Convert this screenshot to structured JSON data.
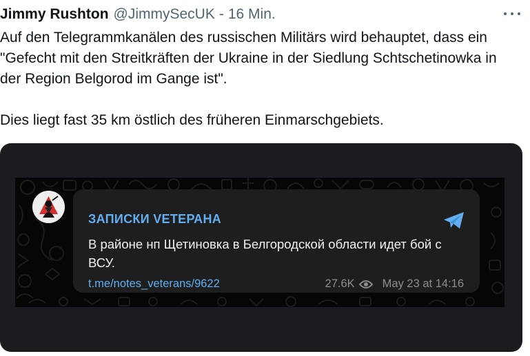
{
  "tweet": {
    "author_name": "Jimmy Rushton",
    "author_handle": "@JimmySecUK",
    "separator": "-",
    "timestamp": "16 Min.",
    "more_icon": "more-horizontal-icon",
    "paragraphs": [
      "Auf den Telegrammkanälen des russischen Militärs wird behauptet, dass ein \"Gefecht mit den Streitkräften der Ukraine in der Siedlung Schtschetinowka in der Region Belgorod im Gange ist\".",
      "Dies liegt fast 35 km östlich des früheren Einmarschgebiets."
    ]
  },
  "telegram_post": {
    "channel_name": "ЗАПИСКИ VЕТЕРАНА",
    "message": "В районе нп Щетиновка в Белгородской области идет бой с ВСУ.",
    "link": "t.me/notes_veterans/9622",
    "views": "27.6K",
    "date": "May 23 at 14:16",
    "accent_color": "#62aef0",
    "icons": [
      "channel-avatar",
      "share-icon",
      "eye-icon"
    ]
  }
}
